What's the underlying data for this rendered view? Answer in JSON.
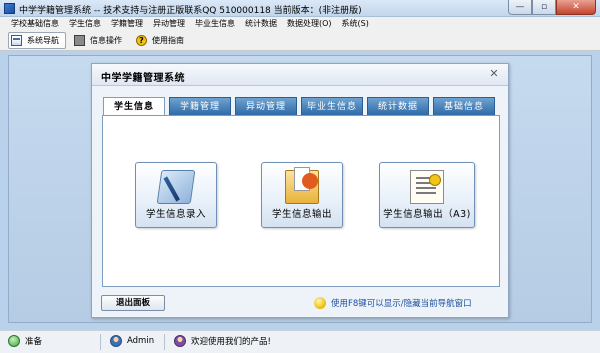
{
  "window": {
    "title": "中学学籍管理系统 -- 技术支持与注册正版联系QQ 510000118  当前版本：(非注册版)",
    "min_label": "—",
    "max_label": "▫",
    "close_label": "✕"
  },
  "menu": {
    "items": [
      {
        "label": "学校基础信息"
      },
      {
        "label": "学生信息"
      },
      {
        "label": "学籍管理"
      },
      {
        "label": "异动管理"
      },
      {
        "label": "毕业生信息"
      },
      {
        "label": "统计数据"
      },
      {
        "label": "数据处理(O)"
      },
      {
        "label": "系统(S)"
      }
    ]
  },
  "toolbar": {
    "items": [
      {
        "label": "系统导航",
        "icon": "navigation-icon",
        "active": true
      },
      {
        "label": "信息操作",
        "icon": "info-operation-icon",
        "active": false
      },
      {
        "label": "使用指南",
        "icon": "help-icon",
        "active": false
      }
    ],
    "help_glyph": "?"
  },
  "dialog": {
    "title": "中学学籍管理系统",
    "close_glyph": "✕",
    "tabs": [
      {
        "label": "学生信息",
        "active": true
      },
      {
        "label": "学籍管理",
        "active": false
      },
      {
        "label": "异动管理",
        "active": false
      },
      {
        "label": "毕业生信息",
        "active": false
      },
      {
        "label": "统计数据",
        "active": false
      },
      {
        "label": "基础信息",
        "active": false
      }
    ],
    "buttons": [
      {
        "label": "学生信息录入",
        "icon": "pen-notepad-icon"
      },
      {
        "label": "学生信息输出",
        "icon": "folder-export-icon"
      },
      {
        "label": "学生信息输出（A3)",
        "icon": "document-list-icon"
      }
    ],
    "exit_label": "退出面板",
    "hint": "使用F8键可以显示/隐藏当前导航窗口"
  },
  "status": {
    "ready": "准备",
    "user": "Admin",
    "welcome": "欢迎使用我们的产品!"
  },
  "colors": {
    "tab_blue": "#2e6ba8",
    "workspace_blue": "#b9d1ea",
    "hint_blue": "#1b4d9c"
  }
}
